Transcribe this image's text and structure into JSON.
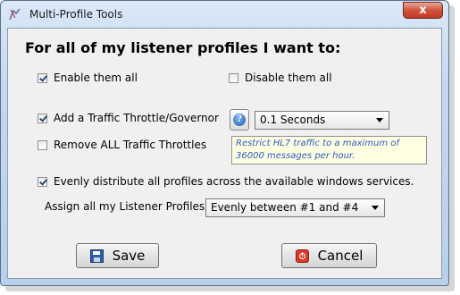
{
  "window": {
    "title": "Multi-Profile Tools",
    "close_label": "x"
  },
  "heading": "For all of my listener profiles I want to:",
  "options": {
    "enable_all": {
      "label": "Enable them all",
      "checked": true
    },
    "disable_all": {
      "label": "Disable them all",
      "checked": false
    },
    "add_throttle": {
      "label": "Add a Traffic Throttle/Governor",
      "checked": true
    },
    "remove_throttles": {
      "label": "Remove ALL Traffic Throttles",
      "checked": false
    },
    "distribute": {
      "label": "Evenly distribute all profiles across the available windows services.",
      "checked": true
    }
  },
  "help": {
    "glyph": "?"
  },
  "throttle_select": {
    "value": "0.1 Seconds"
  },
  "tooltip": "Restrict HL7 traffic to a maximum of 36000 messages per hour.",
  "assign": {
    "label": "Assign all my Listener Profiles",
    "value": "Evenly between #1 and #4"
  },
  "buttons": {
    "save": "Save",
    "cancel": "Cancel"
  }
}
